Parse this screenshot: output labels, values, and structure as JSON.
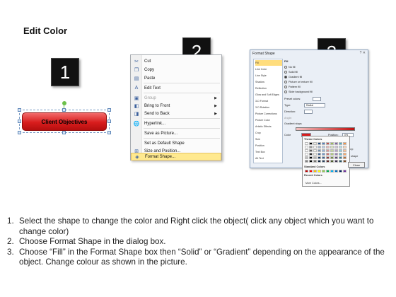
{
  "title": "Edit Color",
  "steps": [
    "1",
    "2",
    "3"
  ],
  "shape": {
    "label": "Client  Objectives",
    "fill_color": "#d81d1d"
  },
  "context_menu": {
    "items": [
      {
        "icon": "scissors",
        "label": "Cut",
        "enabled": true,
        "submenu": false
      },
      {
        "icon": "copy",
        "label": "Copy",
        "enabled": true,
        "submenu": false
      },
      {
        "icon": "clipboard",
        "label": "Paste",
        "enabled": true,
        "submenu": false
      },
      {
        "icon": "text",
        "label": "Edit Text",
        "enabled": true,
        "submenu": false
      },
      {
        "icon": "group",
        "label": "Group",
        "enabled": false,
        "submenu": true
      },
      {
        "icon": "bring-front",
        "label": "Bring to Front",
        "enabled": true,
        "submenu": true
      },
      {
        "icon": "send-back",
        "label": "Send to Back",
        "enabled": true,
        "submenu": true
      },
      {
        "icon": "globe",
        "label": "Hyperlink...",
        "enabled": true,
        "submenu": false
      },
      {
        "icon": "",
        "label": "Save as Picture...",
        "enabled": true,
        "submenu": false
      },
      {
        "icon": "",
        "label": "Set as Default Shape",
        "enabled": true,
        "submenu": false
      },
      {
        "icon": "size",
        "label": "Size and Position...",
        "enabled": true,
        "submenu": false
      },
      {
        "icon": "paint",
        "label": "Format Shape...",
        "enabled": true,
        "submenu": false,
        "highlighted": true
      }
    ]
  },
  "format_dialog": {
    "title": "Format Shape",
    "categories": [
      "Fill",
      "Line Color",
      "Line Style",
      "Shadow",
      "Reflection",
      "Glow and Soft Edges",
      "3-D Format",
      "3-D Rotation",
      "Picture Corrections",
      "Picture Color",
      "Artistic Effects",
      "Crop",
      "Size",
      "Position",
      "Text Box",
      "Alt Text"
    ],
    "selected_category": "Fill",
    "fill_heading": "Fill",
    "fill_options": [
      "No fill",
      "Solid fill",
      "Gradient fill",
      "Picture or texture fill",
      "Pattern fill",
      "Slide background fill"
    ],
    "selected_fill": "Gradient fill",
    "preset_label": "Preset colors:",
    "type_label": "Type:",
    "type_value": "Radial",
    "direction_label": "Direction:",
    "angle_label": "Angle:",
    "gradient_stops_label": "Gradient stops",
    "color_label": "Color",
    "position_label": "Position:",
    "position_value": "0%",
    "brightness_label": "Brightness:",
    "transparency_label": "Transparency:",
    "rotate_label": "Rotate with shape",
    "close_label": "Close"
  },
  "palette": {
    "theme_label": "Theme Colors",
    "standard_label": "Standard Colors",
    "recent_label": "Recent Colors",
    "more_label": "More Colors...",
    "theme_colors": [
      "#ffffff",
      "#000000",
      "#eeece1",
      "#1f497d",
      "#4f81bd",
      "#c0504d",
      "#9bbb59",
      "#8064a2",
      "#4bacc6",
      "#f79646"
    ],
    "standard_colors": [
      "#c00000",
      "#ff0000",
      "#ffc000",
      "#ffff00",
      "#92d050",
      "#00b050",
      "#00b0f0",
      "#0070c0",
      "#002060",
      "#7030a0"
    ]
  },
  "instructions": [
    {
      "num": "1.",
      "text": "Select the shape to change the color and Right click the object( click any object which you want to change color)"
    },
    {
      "num": "2.",
      "text": "Choose Format Shape in the dialog box."
    },
    {
      "num": "3.",
      "text": "Choose “Fill” in the Format Shape box then “Solid” or “Gradient” depending on the appearance of the object. Change colour as shown in the picture."
    }
  ]
}
